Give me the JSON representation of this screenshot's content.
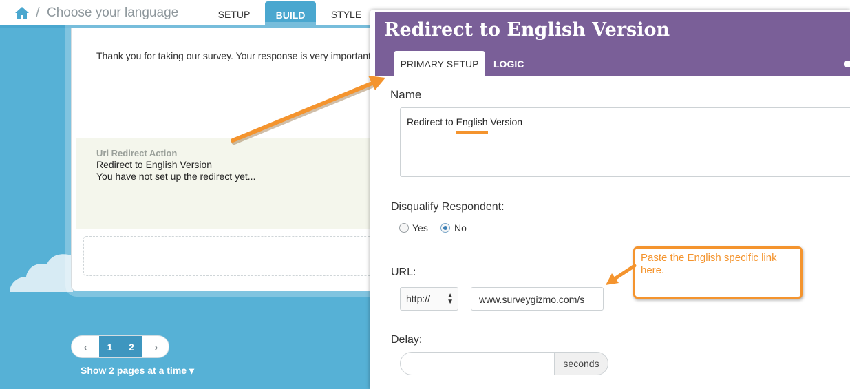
{
  "topbar": {
    "breadcrumb_sep": "/",
    "page_title": "Choose your language",
    "tabs": [
      {
        "label": "SETUP",
        "active": false
      },
      {
        "label": "BUILD",
        "active": true
      },
      {
        "label": "STYLE",
        "active": false
      }
    ]
  },
  "survey_page": {
    "thanks_text": "Thank you for taking our survey. Your response is very important",
    "action": {
      "title": "Url Redirect Action",
      "name": "Redirect to English Version",
      "status": "You have not set up the redirect yet..."
    }
  },
  "pagination": {
    "prev": "‹",
    "pages": [
      "1",
      "2"
    ],
    "next": "›",
    "show_pages_label": "Show 2 pages at a time ▾"
  },
  "modal": {
    "title": "Redirect to English Version",
    "tabs": [
      {
        "label": "PRIMARY SETUP",
        "active": true
      },
      {
        "label": "LOGIC",
        "active": false
      }
    ],
    "name_label": "Name",
    "name_value": "Redirect to English Version",
    "disqualify_label": "Disqualify Respondent:",
    "disqualify_options": [
      {
        "label": "Yes",
        "checked": false
      },
      {
        "label": "No",
        "checked": true
      }
    ],
    "url_label": "URL:",
    "protocol_value": "http://",
    "url_value": "www.surveygizmo.com/s",
    "delay_label": "Delay:",
    "delay_value": "",
    "delay_unit": "seconds"
  },
  "callout": {
    "text": "Paste the English specific link here."
  },
  "colors": {
    "background": "#56b1d6",
    "build_tab": "#4aa7cf",
    "modal_header": "#7a5f98",
    "annotation": "#f4942e",
    "action_bg": "#f4f6ec"
  }
}
